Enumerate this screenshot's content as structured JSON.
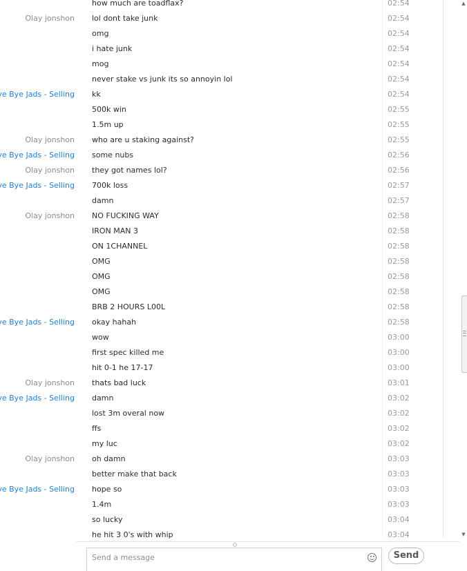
{
  "colors": {
    "sender_blue": "#1f7fd1",
    "sender_gray": "#8c8c8c",
    "message_text": "#2b2b2b",
    "timestamp": "#9a9a9a"
  },
  "messages": [
    {
      "sender": "",
      "sender_style": "",
      "text": "how much are toadflax?",
      "time": "02:54"
    },
    {
      "sender": "Olay jonshon",
      "sender_style": "gray",
      "text": "lol dont take junk",
      "time": "02:54"
    },
    {
      "sender": "",
      "sender_style": "",
      "text": "omg",
      "time": "02:54"
    },
    {
      "sender": "",
      "sender_style": "",
      "text": "i hate junk",
      "time": "02:54"
    },
    {
      "sender": "",
      "sender_style": "",
      "text": "mog",
      "time": "02:54"
    },
    {
      "sender": "",
      "sender_style": "",
      "text": "never stake vs junk its so annoyin lol",
      "time": "02:54"
    },
    {
      "sender": "Bye Bye Jads - Selling",
      "sender_style": "blue",
      "text": "kk",
      "time": "02:54"
    },
    {
      "sender": "",
      "sender_style": "",
      "text": "500k win",
      "time": "02:55"
    },
    {
      "sender": "",
      "sender_style": "",
      "text": "1.5m up",
      "time": "02:55"
    },
    {
      "sender": "Olay jonshon",
      "sender_style": "gray",
      "text": "who are u staking against?",
      "time": "02:55"
    },
    {
      "sender": "Bye Bye Jads - Selling",
      "sender_style": "blue",
      "text": "some nubs",
      "time": "02:56"
    },
    {
      "sender": "Olay jonshon",
      "sender_style": "gray",
      "text": "they got names lol?",
      "time": "02:56"
    },
    {
      "sender": "Bye Bye Jads - Selling",
      "sender_style": "blue",
      "text": "700k loss",
      "time": "02:57"
    },
    {
      "sender": "",
      "sender_style": "",
      "text": "damn",
      "time": "02:57"
    },
    {
      "sender": "Olay jonshon",
      "sender_style": "gray",
      "text": "NO FUCKING WAY",
      "time": "02:58"
    },
    {
      "sender": "",
      "sender_style": "",
      "text": "IRON MAN 3",
      "time": "02:58"
    },
    {
      "sender": "",
      "sender_style": "",
      "text": "ON 1CHANNEL",
      "time": "02:58"
    },
    {
      "sender": "",
      "sender_style": "",
      "text": "OMG",
      "time": "02:58"
    },
    {
      "sender": "",
      "sender_style": "",
      "text": "OMG",
      "time": "02:58"
    },
    {
      "sender": "",
      "sender_style": "",
      "text": "OMG",
      "time": "02:58"
    },
    {
      "sender": "",
      "sender_style": "",
      "text": "BRB 2 HOURS L00L",
      "time": "02:58"
    },
    {
      "sender": "Bye Bye Jads - Selling",
      "sender_style": "blue",
      "text": "okay hahah",
      "time": "02:58"
    },
    {
      "sender": "",
      "sender_style": "",
      "text": "wow",
      "time": "03:00"
    },
    {
      "sender": "",
      "sender_style": "",
      "text": "first spec killed me",
      "time": "03:00"
    },
    {
      "sender": "",
      "sender_style": "",
      "text": "hit 0-1 he 17-17",
      "time": "03:00"
    },
    {
      "sender": "Olay jonshon",
      "sender_style": "gray",
      "text": "thats bad luck",
      "time": "03:01"
    },
    {
      "sender": "Bye Bye Jads - Selling",
      "sender_style": "blue",
      "text": "damn",
      "time": "03:02"
    },
    {
      "sender": "",
      "sender_style": "",
      "text": "lost 3m overal now",
      "time": "03:02"
    },
    {
      "sender": "",
      "sender_style": "",
      "text": "ffs",
      "time": "03:02"
    },
    {
      "sender": "",
      "sender_style": "",
      "text": "my luc",
      "time": "03:02"
    },
    {
      "sender": "Olay jonshon",
      "sender_style": "gray",
      "text": "oh damn",
      "time": "03:03"
    },
    {
      "sender": "",
      "sender_style": "",
      "text": "better make that back",
      "time": "03:03"
    },
    {
      "sender": "Bye Bye Jads - Selling",
      "sender_style": "blue",
      "text": "hope so",
      "time": "03:03"
    },
    {
      "sender": "",
      "sender_style": "",
      "text": "1.4m",
      "time": "03:03"
    },
    {
      "sender": "",
      "sender_style": "",
      "text": "so lucky",
      "time": "03:04"
    },
    {
      "sender": "",
      "sender_style": "",
      "text": "he hit 3 0's with whip",
      "time": "03:04"
    }
  ],
  "compose": {
    "placeholder": "Send a message",
    "value": "",
    "emoticon_icon": "emoticon-icon",
    "send_label": "Send"
  },
  "scrollbar": {
    "up_icon": "scroll-up-arrow-icon",
    "down_icon": "scroll-down-arrow-icon"
  }
}
